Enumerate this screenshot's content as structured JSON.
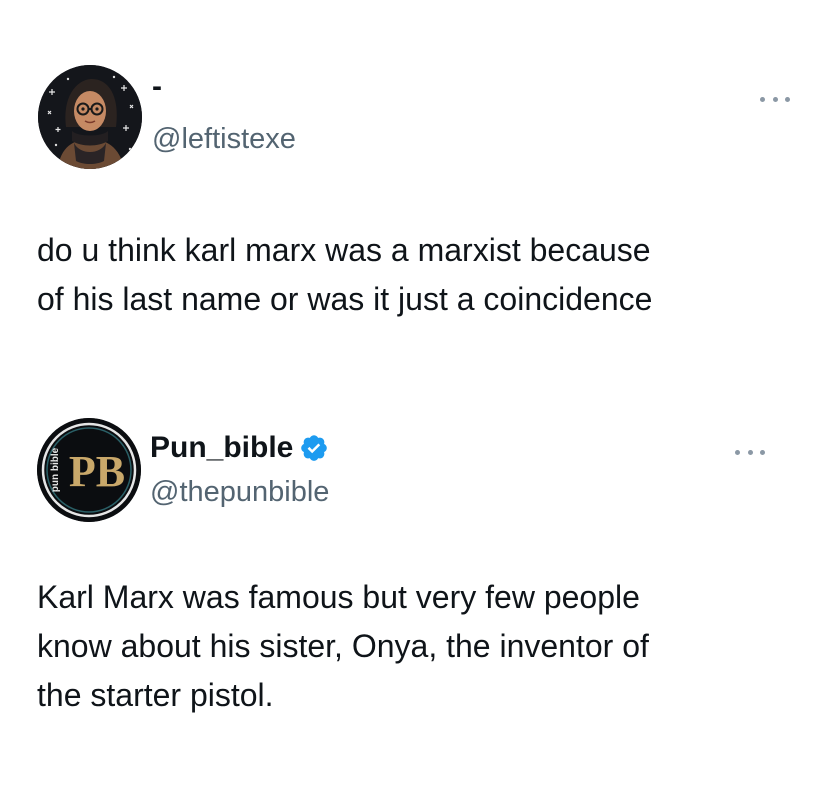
{
  "tweets": [
    {
      "display_name": "-",
      "handle": "@leftistexe",
      "text": "do u think karl marx was a marxist because\nof his last name or was it just a coincidence",
      "avatar": "avatar-illustration"
    },
    {
      "display_name": "Pun_bible",
      "handle": "@thepunbible",
      "verified": true,
      "text": "Karl Marx was famous but very few people\nknow about his sister, Onya, the inventor of\nthe starter pistol.",
      "avatar": {
        "logo_text": "PB",
        "side_text": "pun bible"
      }
    }
  ],
  "colors": {
    "text": "#0f1419",
    "secondary": "#536471",
    "verified": "#1d9bf0",
    "logo_gold": "#c9a86a"
  }
}
